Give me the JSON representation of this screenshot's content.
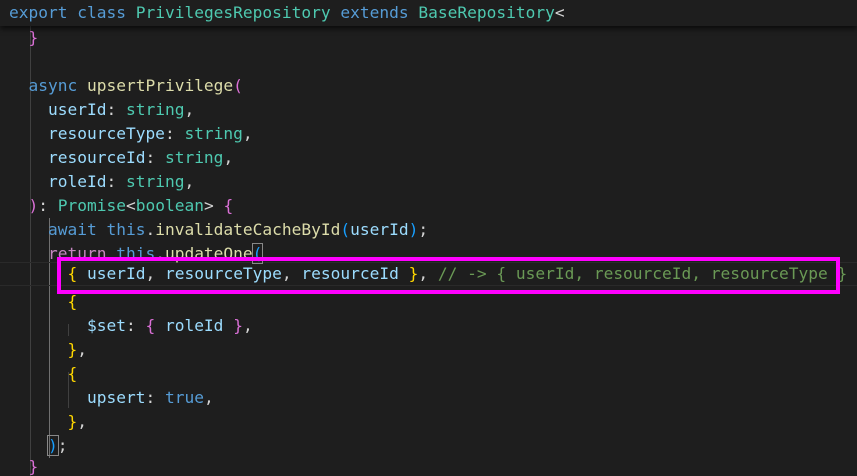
{
  "editor": {
    "theme": {
      "background": "#1e1e1e",
      "highlight_box_color": "#ff00ff",
      "keyword": "#569cd6",
      "function": "#dcdcaa",
      "variable": "#9cdcfe",
      "type": "#4ec9b0",
      "comment": "#6a9955",
      "bracket_gold": "#ffd700",
      "bracket_purple": "#da70d6",
      "bracket_blue": "#179fff"
    },
    "sticky_scroll": {
      "kw_export": "export",
      "kw_class": "class",
      "class_name": "PrivilegesRepository",
      "kw_extends": "extends",
      "base_class": "BaseRepository",
      "open_angle": "<"
    },
    "code": {
      "prev_close_brace": "}",
      "kw_async": "async",
      "method_name": "upsertPrivilege",
      "param_user_id": "userId",
      "param_resource_type": "resourceType",
      "param_resource_id": "resourceId",
      "param_role_id": "roleId",
      "type_string": "string",
      "return_type": "Promise",
      "return_type_arg": "boolean",
      "kw_await": "await",
      "kw_this": "this",
      "invalidate_method": "invalidateCacheById",
      "kw_return": "return",
      "update_method": "updateOne",
      "filter_comment": "// -> { userId, resourceId, resourceType }",
      "set_operator": "$set",
      "upsert_key": "upsert",
      "upsert_value": "true"
    }
  }
}
